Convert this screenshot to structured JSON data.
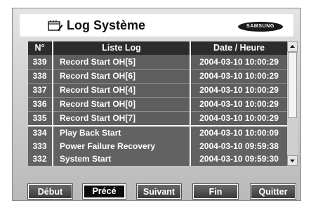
{
  "window": {
    "title": "Log Système",
    "title_icon": "log-notebook-icon",
    "brand": "SAMSUNG"
  },
  "table": {
    "headers": {
      "num": "N°",
      "log": "Liste Log",
      "date": "Date / Heure"
    },
    "rows": [
      {
        "num": "339",
        "log": "Record Start OH[5]",
        "date": "2004-03-10 10:00:29"
      },
      {
        "num": "338",
        "log": "Record Start OH[6]",
        "date": "2004-03-10 10:00:29"
      },
      {
        "num": "337",
        "log": "Record Start OH[4]",
        "date": "2004-03-10 10:00:29"
      },
      {
        "num": "336",
        "log": "Record Start OH[0]",
        "date": "2004-03-10 10:00:29"
      },
      {
        "num": "335",
        "log": "Record Start OH[7]",
        "date": "2004-03-10 10:00:29"
      },
      {
        "num": "334",
        "log": "Play Back Start",
        "date": "2004-03-10 10:00:09"
      },
      {
        "num": "333",
        "log": "Power Failure Recovery",
        "date": "2004-03-10 09:59:38"
      },
      {
        "num": "332",
        "log": "System Start",
        "date": "2004-03-10 09:59:30"
      }
    ]
  },
  "buttons": {
    "debut": "Début",
    "prece": "Précé",
    "suivant": "Suivant",
    "fin": "Fin",
    "quitter": "Quitter"
  },
  "colors": {
    "panel": "#c8c8c8",
    "table_bg": "#5a5a5a",
    "header_bg": "#2c2c2c",
    "active_button": "#0c0c0c"
  }
}
